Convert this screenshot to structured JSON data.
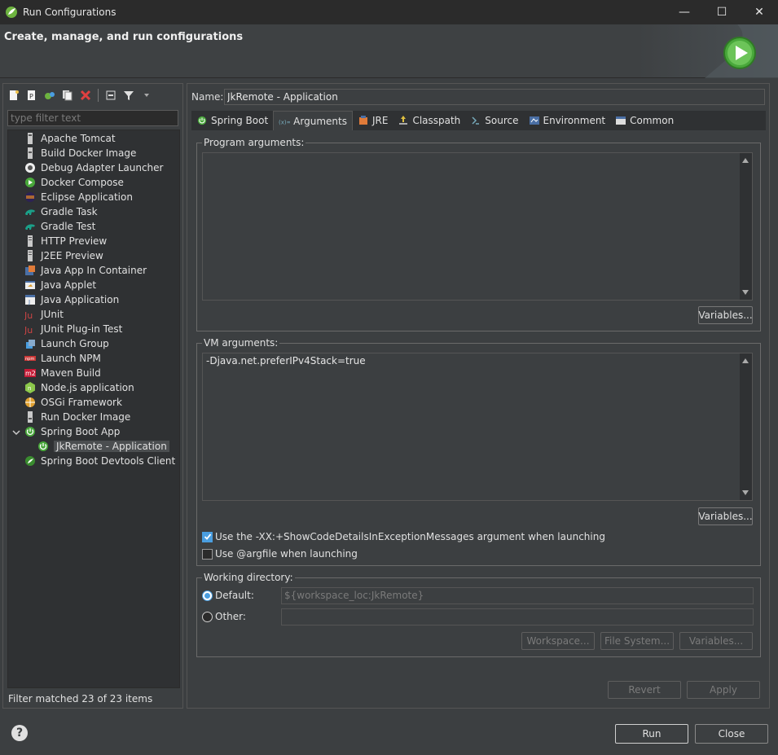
{
  "window": {
    "title": "Run Configurations",
    "minimize": "—",
    "maximize": "☐",
    "close": "✕"
  },
  "banner": {
    "heading": "Create, manage, and run configurations"
  },
  "left": {
    "filter_placeholder": "type filter text",
    "tree_items": [
      {
        "label": "Apache Tomcat",
        "icon": "tomcat-icon"
      },
      {
        "label": "Build Docker Image",
        "icon": "docker-build-icon"
      },
      {
        "label": "Debug Adapter Launcher",
        "icon": "debug-adapter-icon"
      },
      {
        "label": "Docker Compose",
        "icon": "docker-compose-icon"
      },
      {
        "label": "Eclipse Application",
        "icon": "eclipse-icon"
      },
      {
        "label": "Gradle Task",
        "icon": "gradle-icon"
      },
      {
        "label": "Gradle Test",
        "icon": "gradle-icon"
      },
      {
        "label": "HTTP Preview",
        "icon": "server-icon"
      },
      {
        "label": "J2EE Preview",
        "icon": "server-icon"
      },
      {
        "label": "Java App In Container",
        "icon": "java-container-icon"
      },
      {
        "label": "Java Applet",
        "icon": "java-applet-icon"
      },
      {
        "label": "Java Application",
        "icon": "java-app-icon"
      },
      {
        "label": "JUnit",
        "icon": "junit-icon"
      },
      {
        "label": "JUnit Plug-in Test",
        "icon": "junit-plugin-icon"
      },
      {
        "label": "Launch Group",
        "icon": "launch-group-icon"
      },
      {
        "label": "Launch NPM",
        "icon": "npm-icon"
      },
      {
        "label": "Maven Build",
        "icon": "maven-icon"
      },
      {
        "label": "Node.js application",
        "icon": "nodejs-icon"
      },
      {
        "label": "OSGi Framework",
        "icon": "osgi-icon"
      },
      {
        "label": "Run Docker Image",
        "icon": "docker-run-icon"
      },
      {
        "label": "Spring Boot App",
        "icon": "spring-boot-icon"
      },
      {
        "label": "JkRemote - Application",
        "icon": "spring-boot-icon"
      },
      {
        "label": "Spring Boot Devtools Client",
        "icon": "spring-devtools-icon"
      }
    ],
    "filter_status": "Filter matched 23 of 23 items"
  },
  "right": {
    "name_label": "Name:",
    "name_value": "JkRemote - Application",
    "tabs": [
      "Spring Boot",
      "Arguments",
      "JRE",
      "Classpath",
      "Source",
      "Environment",
      "Common"
    ],
    "program_args": {
      "legend": "Program arguments:",
      "value": "",
      "variables": "Variables..."
    },
    "vm_args": {
      "legend": "VM arguments:",
      "value": "-Djava.net.preferIPv4Stack=true",
      "variables": "Variables..."
    },
    "show_code_details": "Use the -XX:+ShowCodeDetailsInExceptionMessages argument when launching",
    "use_argfile": "Use @argfile when launching",
    "working_dir": {
      "legend": "Working directory:",
      "default_label": "Default:",
      "default_value": "${workspace_loc:JkRemote}",
      "other_label": "Other:",
      "workspace_btn": "Workspace...",
      "filesystem_btn": "File System...",
      "variables_btn": "Variables..."
    },
    "revert": "Revert",
    "apply": "Apply"
  },
  "footer": {
    "run": "Run",
    "close": "Close",
    "help": "?"
  }
}
